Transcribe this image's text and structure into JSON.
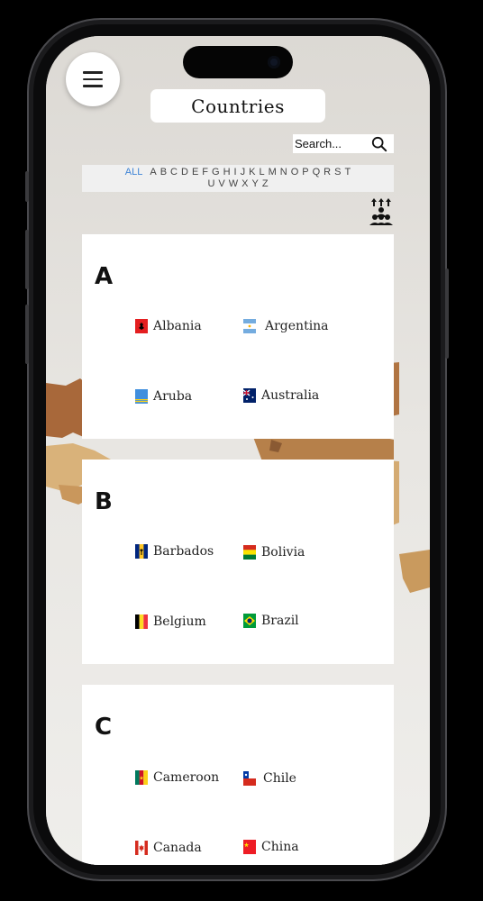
{
  "header": {
    "title": "Countries"
  },
  "search": {
    "placeholder": "Search..."
  },
  "alphabet": {
    "all_label": "ALL",
    "letters": [
      "A",
      "B",
      "C",
      "D",
      "E",
      "F",
      "G",
      "H",
      "I",
      "J",
      "K",
      "L",
      "M",
      "N",
      "O",
      "P",
      "Q",
      "R",
      "S",
      "T",
      "U",
      "V",
      "W",
      "X",
      "Y",
      "Z"
    ]
  },
  "sections": [
    {
      "letter": "A",
      "countries": [
        {
          "name": "Albania",
          "flag": "flag-albania-icon"
        },
        {
          "name": "Argentina",
          "flag": "flag-argentina-icon"
        },
        {
          "name": "Aruba",
          "flag": "flag-aruba-icon"
        },
        {
          "name": "Australia",
          "flag": "flag-australia-icon"
        }
      ]
    },
    {
      "letter": "B",
      "countries": [
        {
          "name": "Barbados",
          "flag": "flag-barbados-icon"
        },
        {
          "name": "Bolivia",
          "flag": "flag-bolivia-icon"
        },
        {
          "name": "Belgium",
          "flag": "flag-belgium-icon"
        },
        {
          "name": "Brazil",
          "flag": "flag-brazil-icon"
        }
      ]
    },
    {
      "letter": "C",
      "countries": [
        {
          "name": "Cameroon",
          "flag": "flag-cameroon-icon"
        },
        {
          "name": "Chile",
          "flag": "flag-chile-icon"
        },
        {
          "name": "Canada",
          "flag": "flag-canada-icon"
        },
        {
          "name": "China",
          "flag": "flag-china-icon"
        }
      ]
    }
  ],
  "colors": {
    "accent": "#3f84d6",
    "card": "#ffffff",
    "background": "#e6e4e0"
  }
}
